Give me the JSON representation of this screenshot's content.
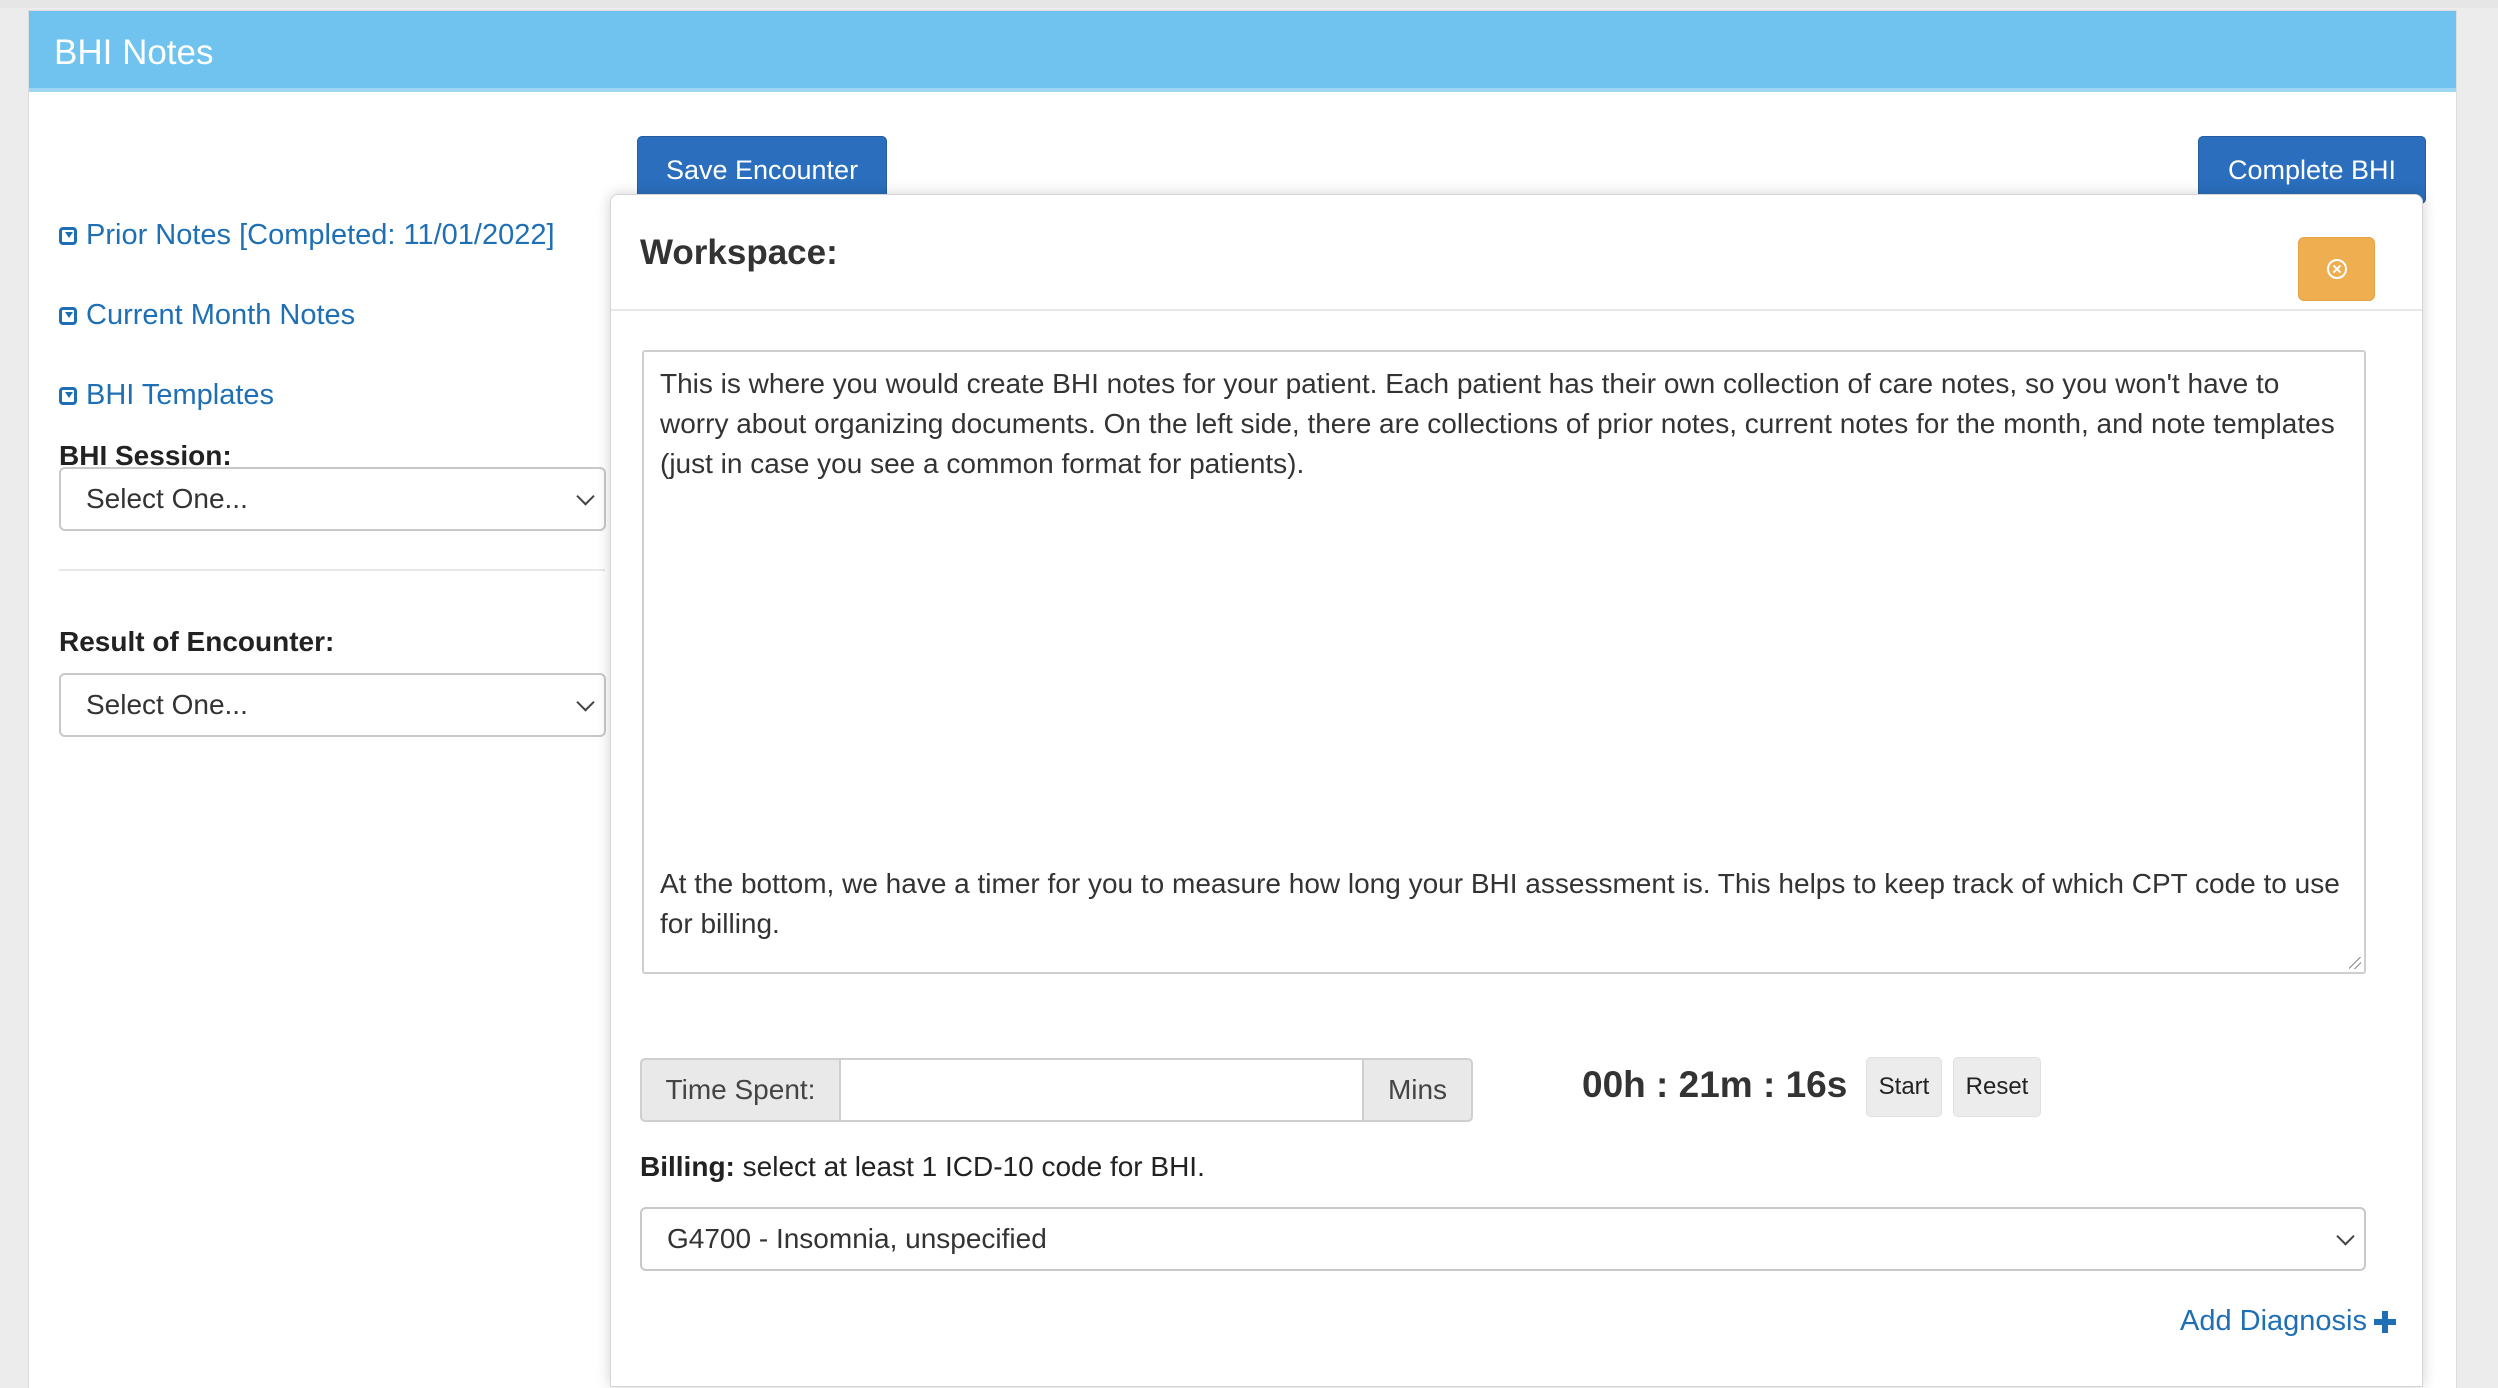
{
  "panel": {
    "title": "BHI Notes"
  },
  "sidebar": {
    "links": [
      {
        "label": "Prior Notes [Completed: 11/01/2022]",
        "icon": "collapse-toggle-icon"
      },
      {
        "label": "Current Month Notes",
        "icon": "collapse-toggle-icon"
      },
      {
        "label": "BHI Templates",
        "icon": "collapse-toggle-icon"
      }
    ],
    "session_label": "BHI Session:",
    "session_value": "Select One...",
    "result_label": "Result of Encounter:",
    "result_value": "Select One..."
  },
  "toolbar": {
    "save_label": "Save Encounter",
    "complete_label": "Complete BHI"
  },
  "workspace": {
    "title": "Workspace:",
    "notes_paragraph_1": "This is where you would create BHI notes for your patient. Each patient has their own collection of care notes, so you won't have to worry about organizing documents. On the left side, there are collections of prior notes, current notes for the month, and note templates (just in case you see a common format for patients).",
    "notes_paragraph_2": "At the bottom, we have a timer for you to measure how long your BHI assessment is. This helps to keep track of which CPT code to use for billing.",
    "time_spent_label": "Time Spent:",
    "time_spent_value": "",
    "time_unit": "Mins",
    "timer": "00h : 21m : 16s",
    "start_label": "Start",
    "reset_label": "Reset",
    "billing_strong": "Billing:",
    "billing_text": " select at least 1 ICD-10 code for BHI.",
    "diagnosis_value": "G4700 - Insomnia, unspecified",
    "add_diagnosis_label": "Add Diagnosis"
  },
  "colors": {
    "header": "#6fc3ee",
    "primary_button": "#2a6ebd",
    "link": "#1f6fb5",
    "close_button": "#efae50"
  }
}
